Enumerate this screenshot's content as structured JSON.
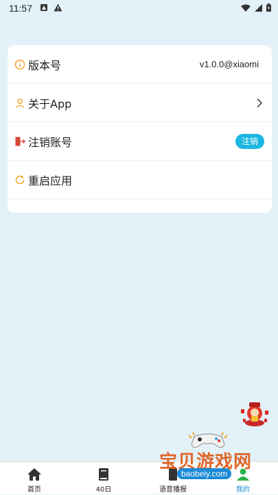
{
  "status_bar": {
    "time": "11:57"
  },
  "settings": {
    "items": [
      {
        "label": "版本号",
        "value": "v1.0.0@xiaomi",
        "icon": "info-icon"
      },
      {
        "label": "关于App",
        "icon": "person-icon"
      },
      {
        "label": "注销账号",
        "button": "注销",
        "icon": "logout-icon"
      },
      {
        "label": "重启应用",
        "icon": "refresh-icon"
      }
    ]
  },
  "tabbar": {
    "tabs": [
      {
        "label": "首页",
        "icon": "home-icon"
      },
      {
        "label": "40日",
        "icon": "book-icon"
      },
      {
        "label": "语音播报",
        "icon": "speaker-icon"
      },
      {
        "label": "我的",
        "icon": "user-icon",
        "active": true
      }
    ]
  },
  "watermark": {
    "title": "宝贝游戏网",
    "url": "baobeiy.com"
  },
  "colors": {
    "accent": "#1bb7e0",
    "icon_orange": "#f0a020",
    "logout_red": "#d9443a",
    "active_tab": "#1a8ad0",
    "background": "#e3f1f8"
  }
}
